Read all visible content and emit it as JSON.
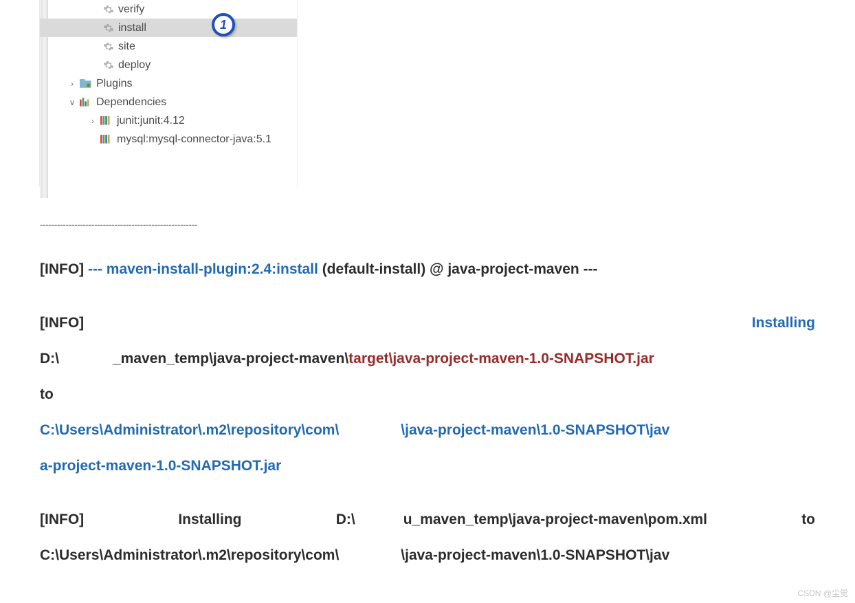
{
  "tree": {
    "goals": {
      "verify": "verify",
      "install": "install",
      "site": "site",
      "deploy": "deploy"
    },
    "plugins_label": "Plugins",
    "dependencies_label": "Dependencies",
    "deps": {
      "junit": "junit:junit:4.12",
      "mysql": "mysql:mysql-connector-java:5.1"
    }
  },
  "callout": "1",
  "divider_text": "-------------------------------------------------------",
  "log": {
    "info_label": "[INFO]",
    "plugin_call": " --- maven-install-plugin:2.4:install ",
    "plugin_tail": "(default-install) @ java-project-maven ---",
    "installing": "Installing",
    "path_prefix_a": "D:\\",
    "path_mid_a": "_maven_temp\\java-project-maven\\",
    "path_red": "target\\java-project-maven-1.0-SNAPSHOT.jar",
    "to": "to",
    "repo1a": "C:\\Users\\Administrator\\.m2\\repository\\com\\",
    "repo1b": "\\java-project-maven\\1.0-SNAPSHOT\\jav",
    "repo1c": "a-project-maven-1.0-SNAPSHOT.jar",
    "installing2": "Installing",
    "pom_a": "D:\\",
    "pom_b": "u_maven_temp\\java-project-maven\\pom.xml",
    "pom_to": "to",
    "repo2a": "C:\\Users\\Administrator\\.m2\\repository\\com\\",
    "repo2b": "\\java-project-maven\\1.0-SNAPSHOT\\jav"
  },
  "watermark": "CSDN @尘觉"
}
